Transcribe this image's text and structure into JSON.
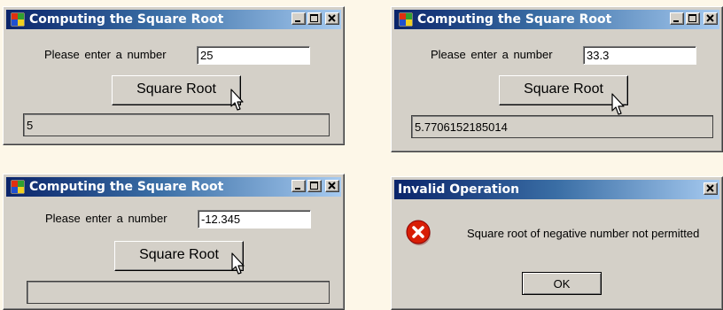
{
  "windows": [
    {
      "title": "Computing the Square Root",
      "prompt_label": "Please  enter  a number",
      "input_value": "25",
      "button_label": "Square Root",
      "result": "5"
    },
    {
      "title": "Computing the Square Root",
      "prompt_label": "Please  enter  a number",
      "input_value": "33.3",
      "button_label": "Square Root",
      "result": "5.7706152185014"
    },
    {
      "title": "Computing the Square Root",
      "prompt_label": "Please  enter  a number",
      "input_value": "-12.345",
      "button_label": "Square Root",
      "result": ""
    }
  ],
  "dialog": {
    "title": "Invalid Operation",
    "message": "Square root of negative number not permitted",
    "ok_label": "OK"
  },
  "icons": {
    "app": "app-window-icon",
    "minimize": "minimize-icon",
    "maximize": "maximize-icon",
    "close": "close-icon",
    "error": "error-icon",
    "cursor": "mouse-pointer-icon"
  },
  "colors": {
    "title_start": "#0a246a",
    "title_end": "#a6caf0",
    "face": "#d4d0c8",
    "error_red": "#d81e06"
  }
}
